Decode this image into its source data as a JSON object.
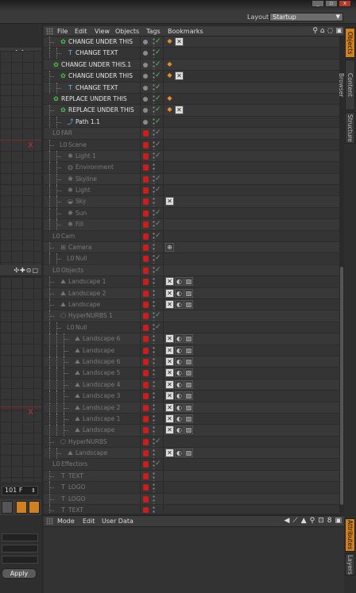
{
  "window": {
    "min": "_",
    "max": "▫",
    "close": "x"
  },
  "layout": {
    "label": "Layout:",
    "value": "Startup"
  },
  "viewport": {
    "axis_x": "X",
    "icons": "✣✚⊙▢"
  },
  "timeline": {
    "frame": "101 F"
  },
  "apply_label": "Apply",
  "objects_menu": [
    "File",
    "Edit",
    "View",
    "Objects",
    "Tags",
    "Bookmarks"
  ],
  "attr_menu": [
    "Mode",
    "Edit",
    "User Data"
  ],
  "side_tabs_top": [
    "Objects",
    "Content Browser",
    "Structure"
  ],
  "side_tabs_bottom": [
    "Attributes",
    "Layers"
  ],
  "rows": [
    {
      "name": "CHANGE UNDER THIS",
      "indent": 1,
      "icon": "cloner",
      "dim": false,
      "layer": "gray",
      "tags": [
        "orange",
        "x"
      ]
    },
    {
      "name": "CHANGE TEXT",
      "indent": 2,
      "icon": "text",
      "dim": false,
      "layer": "gray",
      "tags": []
    },
    {
      "name": "CHANGE UNDER THIS.1",
      "indent": 0,
      "icon": "cloner",
      "dim": false,
      "layer": "gray",
      "tags": [
        "orange"
      ]
    },
    {
      "name": "CHANGE UNDER THIS",
      "indent": 1,
      "icon": "cloner",
      "dim": false,
      "layer": "gray",
      "tags": [
        "orange",
        "x"
      ]
    },
    {
      "name": "CHANGE TEXT",
      "indent": 2,
      "icon": "text",
      "dim": false,
      "layer": "gray",
      "tags": []
    },
    {
      "name": "REPLACE UNDER THIS",
      "indent": 0,
      "icon": "cloner",
      "dim": false,
      "layer": "gray",
      "tags": [
        "orange"
      ]
    },
    {
      "name": "REPLACE UNDER THIS",
      "indent": 1,
      "icon": "cloner",
      "dim": false,
      "layer": "gray",
      "tags": [
        "orange",
        "x"
      ]
    },
    {
      "name": "Path 1.1",
      "indent": 2,
      "icon": "path",
      "dim": false,
      "layer": "gray",
      "tags": []
    },
    {
      "name": "FAR",
      "indent": 0,
      "icon": "null",
      "dim": true,
      "layer": "red",
      "tags": []
    },
    {
      "name": "Scene",
      "indent": 1,
      "icon": "null",
      "dim": true,
      "layer": "red",
      "tags": []
    },
    {
      "name": "Light 1",
      "indent": 2,
      "icon": "light",
      "dim": true,
      "layer": "red",
      "tags": []
    },
    {
      "name": "Environment",
      "indent": 2,
      "icon": "env",
      "dim": true,
      "layer": "red",
      "tags": []
    },
    {
      "name": "Skyline",
      "indent": 2,
      "icon": "light",
      "dim": true,
      "layer": "red",
      "tags": []
    },
    {
      "name": "Light",
      "indent": 2,
      "icon": "light",
      "dim": true,
      "layer": "red",
      "tags": []
    },
    {
      "name": "Sky",
      "indent": 2,
      "icon": "sky",
      "dim": true,
      "layer": "red",
      "tags": [
        "x"
      ]
    },
    {
      "name": "Sun",
      "indent": 2,
      "icon": "light",
      "dim": true,
      "layer": "red",
      "tags": []
    },
    {
      "name": "Fill",
      "indent": 2,
      "icon": "light",
      "dim": true,
      "layer": "red",
      "tags": []
    },
    {
      "name": "Cam",
      "indent": 0,
      "icon": "null",
      "dim": true,
      "layer": "red",
      "tags": []
    },
    {
      "name": "Camera",
      "indent": 1,
      "icon": "camera",
      "dim": true,
      "layer": "red",
      "tags": [
        "cam"
      ]
    },
    {
      "name": "Null",
      "indent": 2,
      "icon": "null",
      "dim": true,
      "layer": "red",
      "tags": []
    },
    {
      "name": "Objects",
      "indent": 0,
      "icon": "null",
      "dim": true,
      "layer": "red",
      "tags": []
    },
    {
      "name": "Landscape 1",
      "indent": 1,
      "icon": "landscape",
      "dim": true,
      "layer": "red",
      "tags": [
        "x",
        "s",
        "c"
      ]
    },
    {
      "name": "Landscape 2",
      "indent": 1,
      "icon": "landscape",
      "dim": true,
      "layer": "red",
      "tags": [
        "x",
        "s",
        "c"
      ]
    },
    {
      "name": "Landscape",
      "indent": 1,
      "icon": "landscape",
      "dim": true,
      "layer": "red",
      "tags": [
        "x",
        "s",
        "c"
      ]
    },
    {
      "name": "HyperNURBS 1",
      "indent": 1,
      "icon": "hnurbs",
      "dim": true,
      "layer": "red",
      "tags": []
    },
    {
      "name": "Null",
      "indent": 2,
      "icon": "null",
      "dim": true,
      "layer": "red",
      "tags": []
    },
    {
      "name": "Landscape 6",
      "indent": 3,
      "icon": "landscape",
      "dim": true,
      "layer": "red",
      "tags": [
        "x",
        "s",
        "c"
      ]
    },
    {
      "name": "Landscape",
      "indent": 3,
      "icon": "landscape",
      "dim": true,
      "layer": "red",
      "tags": [
        "x",
        "s",
        "c"
      ]
    },
    {
      "name": "Landscape 6",
      "indent": 3,
      "icon": "landscape",
      "dim": true,
      "layer": "red",
      "tags": [
        "x",
        "s",
        "c"
      ]
    },
    {
      "name": "Landscape 5",
      "indent": 3,
      "icon": "landscape",
      "dim": true,
      "layer": "red",
      "tags": [
        "x",
        "s",
        "c"
      ]
    },
    {
      "name": "Landscape 4",
      "indent": 3,
      "icon": "landscape",
      "dim": true,
      "layer": "red",
      "tags": [
        "x",
        "s",
        "c"
      ]
    },
    {
      "name": "Landscape 3",
      "indent": 3,
      "icon": "landscape",
      "dim": true,
      "layer": "red",
      "tags": [
        "x",
        "s",
        "c"
      ]
    },
    {
      "name": "Landscape 2",
      "indent": 3,
      "icon": "landscape",
      "dim": true,
      "layer": "red",
      "tags": [
        "x",
        "s",
        "c"
      ]
    },
    {
      "name": "Landscape 1",
      "indent": 3,
      "icon": "landscape",
      "dim": true,
      "layer": "red",
      "tags": [
        "x",
        "s",
        "c"
      ]
    },
    {
      "name": "Landscape",
      "indent": 3,
      "icon": "landscape",
      "dim": true,
      "layer": "red",
      "tags": [
        "x",
        "s",
        "c"
      ]
    },
    {
      "name": "HyperNURBS",
      "indent": 1,
      "icon": "hnurbs",
      "dim": true,
      "layer": "red",
      "tags": []
    },
    {
      "name": "Landscape",
      "indent": 2,
      "icon": "landscape",
      "dim": true,
      "layer": "red",
      "tags": [
        "x",
        "s",
        "c"
      ]
    },
    {
      "name": "Effectors",
      "indent": 0,
      "icon": "null",
      "dim": true,
      "layer": "red",
      "tags": []
    },
    {
      "name": "TEXT",
      "indent": 1,
      "icon": "text",
      "dim": true,
      "layer": "red",
      "tags": []
    },
    {
      "name": "LOGO",
      "indent": 1,
      "icon": "text",
      "dim": true,
      "layer": "red",
      "tags": []
    },
    {
      "name": "LOGO",
      "indent": 1,
      "icon": "text",
      "dim": true,
      "layer": "red",
      "tags": []
    },
    {
      "name": "TEXT",
      "indent": 1,
      "icon": "text",
      "dim": true,
      "layer": "red",
      "tags": []
    }
  ]
}
